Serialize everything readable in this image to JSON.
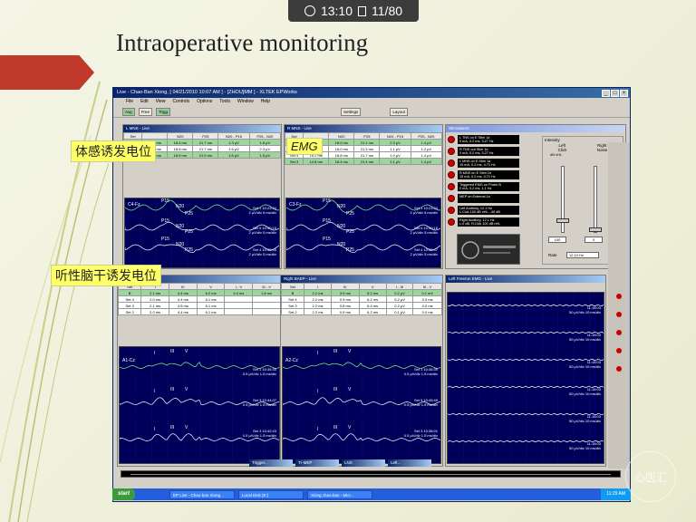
{
  "topbar": {
    "time": "13:10",
    "page": "11/80"
  },
  "slide": {
    "title": "Intraoperative monitoring"
  },
  "labels": {
    "ssep": "体感诱发电位",
    "emg": "EMG",
    "baep": "听性脑干诱发电位"
  },
  "window": {
    "title": "Live - Chao-Ban Xiong, [ 04/21/2010 10:07 AM ] - [ZHOU]MM ] - XLTEK EPWorks",
    "menu": [
      "File",
      "Edit",
      "View",
      "Controls",
      "Options",
      "Tools",
      "Window",
      "Help"
    ],
    "toolbar": [
      "Avg",
      "Free",
      "Trigg",
      "Settings",
      "Layout"
    ]
  },
  "panels": {
    "l_mns": {
      "title": "L MNS - Live",
      "headers": [
        "Set",
        "",
        "N20",
        "P25",
        "N20 - P15",
        "P25 - N20"
      ],
      "rows": [
        [
          "Set 4",
          "14.5 ms",
          "18.4 ms",
          "21.7 ms",
          "1.3 µV",
          "1.8 µV"
        ],
        [
          "Set 4",
          "14.6 ms",
          "18.8 ms",
          "21.7 ms",
          "1.6 µV",
          "2.3 µV"
        ],
        [
          "Set 5",
          "14.6 ms",
          "18.9 ms",
          "21.9 ms",
          "1.6 µV",
          "1.5 µV"
        ]
      ],
      "chan": "C4-Fz",
      "peaks": [
        "P15",
        "N20",
        "P25",
        "P15",
        "N20",
        "P25",
        "P15",
        "N20",
        "P25"
      ],
      "annots": [
        "Set 1 10:23:34\n2 µV/div 5 ms/div",
        "Set 5 10:40:16\n2 µV/div 5 ms/div",
        "Set 4 10:38:45\n2 µV/div 5 ms/div"
      ]
    },
    "r_mns": {
      "title": "R MNS - Live",
      "headers": [
        "Set",
        "",
        "N20",
        "P25",
        "N20 - P15",
        "P25 - N20"
      ],
      "rows": [
        [
          "Set 1",
          "14.5 ms",
          "18.0 ms",
          "21.1 ms",
          "2.3 µV",
          "1.4 µV"
        ],
        [
          "Set 5",
          "14.6 ms",
          "18.0 ms",
          "21.3 ms",
          "1.1 µV",
          "1.2 µV"
        ],
        [
          "Set 4",
          "15.2 ms",
          "18.8 ms",
          "21.7 ms",
          "1.0 µV",
          "1.4 µV"
        ],
        [
          "Set 3",
          "14.8 ms",
          "18.4 ms",
          "21.4 ms",
          "1.1 µV",
          "1.4 µV"
        ]
      ],
      "chan": "C3-Fz",
      "peaks": [
        "P15",
        "N20",
        "P25",
        "P15",
        "N20",
        "P25",
        "P15",
        "N20",
        "P25"
      ],
      "annots": [
        "Set 1 10:23:34\n2 µV/div 5 ms/div",
        "Set 5 10:40:16\n2 µV/div 5 ms/div",
        "Set 4 10:38:47\n2 µV/div 5 ms/div"
      ]
    },
    "stim": {
      "title": "Stimulators",
      "items": [
        "L TNS on E Stim 1d\n0 mA, 0.2 ms, 3.27 Hz",
        "R TNS out Stim 1e\n0 mA, 0.2 ms, 3.27 Hz",
        "L MNS on E Stim 1a\n15 mA, 0.2 ms, 4.71 Hz",
        "R MNS on E Stim 1b\n15 mA, 0.2 ms, 4.71 Hz",
        "Triggered EMG on Probe B\n0 mA, 0.2 ms, 1.1 Hz",
        "MEP on External 1a",
        "Left Auditory, 12.1 Hz\nL:Clck 100 dB nHL, -40 dB",
        "Right Auditory, 12.1 Hz\nL:0 dB, R:Clck 100 dB nHL"
      ],
      "intensity": "Intensity",
      "left": "Left",
      "right": "Right",
      "click": "Click",
      "noise": "Noise",
      "db": "dB nHL",
      "v1": "100",
      "v2": "0",
      "rate": "Rate",
      "rateval": "12.10 Hz"
    },
    "l_baep": {
      "title": "Left BAEP - Live",
      "headers": [
        "Set",
        "I",
        "III",
        "V",
        "I - V",
        "III - V"
      ],
      "rows": [
        [
          "B",
          "2.1 ms",
          "4.4 ms",
          "6.2 ms",
          "4.0 ms",
          "1.8 ms"
        ],
        [
          "Set 4",
          "2.0 ms",
          "4.4 ms",
          "6.1 ms",
          "",
          ""
        ],
        [
          "Set 3",
          "2.1 ms",
          "4.5 ms",
          "6.1 ms",
          "",
          ""
        ],
        [
          "Set 2",
          "2.0 ms",
          "4.4 ms",
          "6.1 ms",
          "",
          ""
        ]
      ],
      "chan": "A1-Cz",
      "peaks": [
        "I",
        "III",
        "V",
        "I",
        "III",
        "V",
        "I",
        "III",
        "V"
      ],
      "annots": [
        "Set 1 10:35:30\n0.5 µV/div 1.5 ms/div",
        "Set 3 10:44:07\n0.5 µV/div 1.5 ms/div",
        "Set 3 10:42:43\n0.5 µV/div 1.5 ms/div"
      ]
    },
    "r_baep": {
      "title": "Right BAEP - Live",
      "headers": [
        "Set",
        "I",
        "III",
        "V",
        "I - III",
        "III - V"
      ],
      "rows": [
        [
          "B",
          "2.2 ms",
          "3.9 ms",
          "6.2 ms",
          "0.2 µV",
          "0.2 mV"
        ],
        [
          "Set 4",
          "2.2 ms",
          "0.9 ms",
          "6.2 ms",
          "0.2 µV",
          "0.0 ms"
        ],
        [
          "Set 3",
          "2.2 ms",
          "0.8 ms",
          "6.4 ms",
          "0.2 µV",
          "0.0 ms"
        ],
        [
          "Set 2",
          "2.2 ms",
          "0.9 ms",
          "6.2 ms",
          "0.1 µV",
          "0.0 ms"
        ]
      ],
      "chan": "A2-Cz",
      "peaks": [
        "I",
        "III",
        "V",
        "I",
        "III",
        "V",
        "I",
        "III",
        "V"
      ],
      "annots": [
        "Set 1 10:36:39\n0.5 µV/div 1.5 ms/div",
        "Set 5 10:45:49\n0.5 µV/div 1.5 ms/div",
        "Set 3 10:38:01\n0.5 µV/div 1.5 ms/div"
      ]
    },
    "free": {
      "title": "Left Freerun EMG - Live",
      "annots": [
        "11:18:03\n50 µV/div 10 ms/div",
        "11:18:03\n50 µV/div 10 ms/div",
        "11:18:03\n50 µV/div 10 ms/div",
        "11:18:03\n50 µV/div 10 ms/div",
        "11:18:03\n50 µV/div 10 ms/div",
        "11:18:03\n50 µV/div 10 ms/div"
      ]
    }
  },
  "minimized": [
    "Trigger...",
    "Tr-MEP",
    "LNS",
    "Left..."
  ],
  "taskbar": {
    "start": "start",
    "tasks": [
      "EP Live - Chao-ban Xiong...",
      "Local Disk (E:)",
      "Xiong chao-ban - Micr..."
    ],
    "time": "11:29 AM"
  },
  "watermark": "心医汇"
}
